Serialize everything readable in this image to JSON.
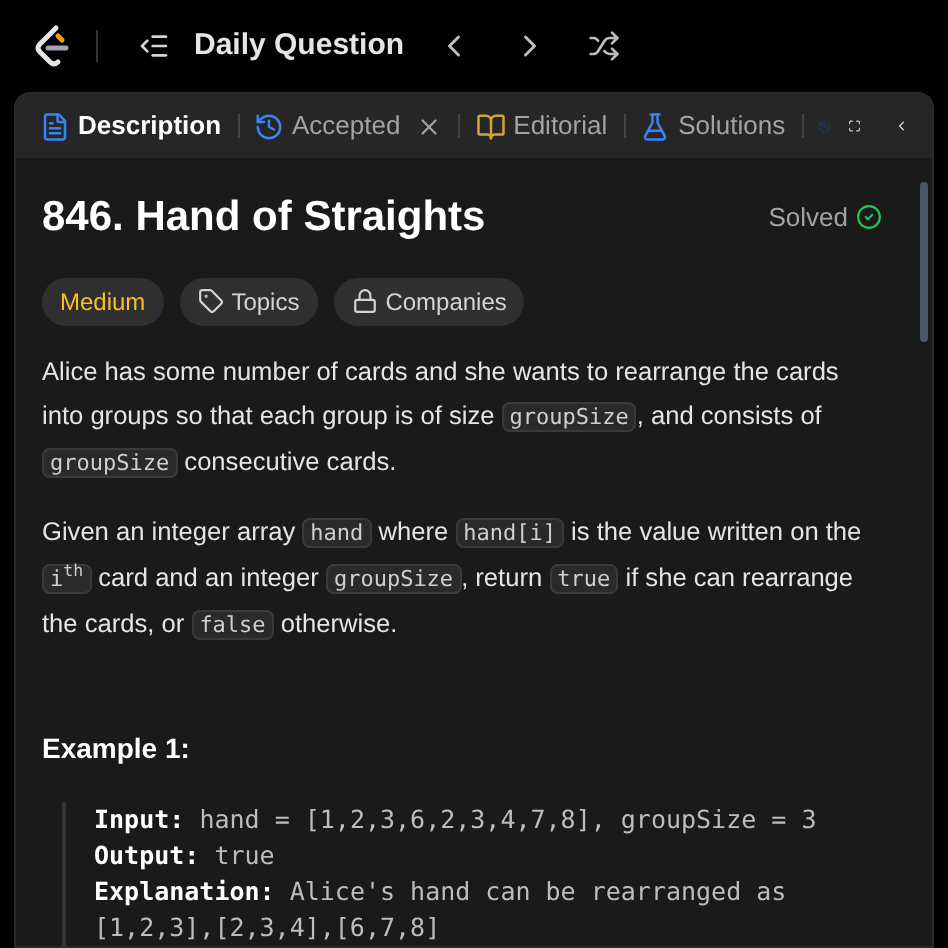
{
  "top_bar": {
    "title": "Daily Question"
  },
  "tabs": [
    {
      "label": "Description",
      "kind": "description",
      "selected": true,
      "closable": false
    },
    {
      "label": "Accepted",
      "kind": "accepted",
      "selected": false,
      "closable": true
    },
    {
      "label": "Editorial",
      "kind": "editorial",
      "selected": false,
      "closable": false
    },
    {
      "label": "Solutions",
      "kind": "solutions",
      "selected": false,
      "closable": false
    }
  ],
  "problem": {
    "title": "846. Hand of Straights",
    "status": "Solved",
    "solved": true,
    "tags": [
      {
        "label": "Medium",
        "kind": "difficulty"
      },
      {
        "label": "Topics",
        "kind": "topics"
      },
      {
        "label": "Companies",
        "kind": "companies"
      }
    ],
    "paragraphs": [
      [
        {
          "kind": "text",
          "text": "Alice has some number of cards and she wants to rearrange the cards into groups so that each group is of size "
        },
        {
          "kind": "code",
          "text": "groupSize"
        },
        {
          "kind": "text",
          "text": ", and consists of "
        },
        {
          "kind": "code",
          "text": "groupSize"
        },
        {
          "kind": "text",
          "text": " consecutive cards."
        }
      ],
      [
        {
          "kind": "text",
          "text": "Given an integer array "
        },
        {
          "kind": "code",
          "text": "hand"
        },
        {
          "kind": "text",
          "text": " where "
        },
        {
          "kind": "code",
          "text": "hand[i]"
        },
        {
          "kind": "text",
          "text": " is the value written on the "
        },
        {
          "kind": "code",
          "text": "i$^{th}$"
        },
        {
          "kind": "text",
          "text": " card and an integer "
        },
        {
          "kind": "code",
          "text": "groupSize"
        },
        {
          "kind": "text",
          "text": ", return "
        },
        {
          "kind": "code",
          "text": "true"
        },
        {
          "kind": "text",
          "text": " if she can rearrange the cards, or "
        },
        {
          "kind": "code",
          "text": "false"
        },
        {
          "kind": "text",
          "text": " otherwise."
        }
      ]
    ],
    "example": {
      "title": "Example 1:",
      "lines": [
        {
          "label": "Input:",
          "value": "hand = [1,2,3,6,2,3,4,7,8], groupSize = 3"
        },
        {
          "label": "Output:",
          "value": "true"
        },
        {
          "label": "Explanation:",
          "value": "Alice's hand can be rearranged as [1,2,3],[2,3,4],[6,7,8]"
        }
      ]
    }
  }
}
